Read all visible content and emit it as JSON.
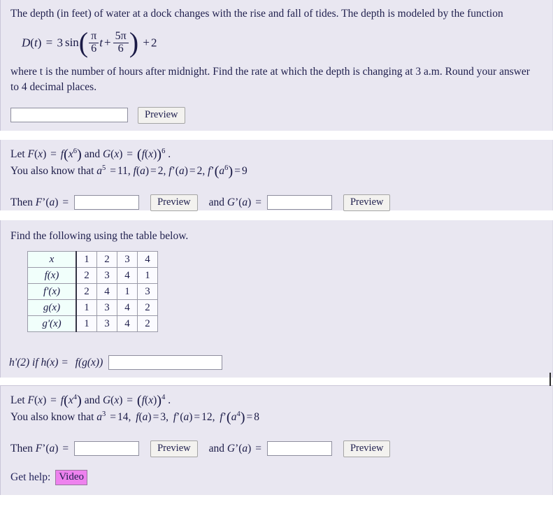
{
  "theme": {
    "panel_bg": "#e9e7f1",
    "page_bg": "#ffffff",
    "text_color": "#1f1f4d",
    "input_bg": "#ffffff",
    "button_bg": "#f3f2ef",
    "link_highlight": "#ee82ee",
    "table_head_bg": "#f1fffb",
    "table_cell_bg": "#fbfbff"
  },
  "problems": [
    {
      "id": "tides-problem",
      "prompt_line1": "The depth (in feet) of water at a dock changes with the rise and fall of tides. The depth is modeled by the function",
      "formula": {
        "lhs_fn": "D",
        "lhs_var": "t",
        "equals": "=",
        "coefficient": "3",
        "trig": "sin",
        "arg_frac1_num": "π",
        "arg_frac1_den": "6",
        "arg_var": "t",
        "arg_plus": "+",
        "arg_frac2_num": "5π",
        "arg_frac2_den": "6",
        "tail_plus": "+",
        "tail_const": "2"
      },
      "prompt_line2": "where t is the number of hours after midnight. Find the rate at which the depth is changing at 3 a.m.  Round your answer",
      "prompt_line3": "to 4 decimal places.",
      "answer_value": "",
      "answer_placeholder": "",
      "preview_label": "Preview"
    },
    {
      "id": "composite-power-6",
      "line1_prefix": "Let",
      "line1_F": "F",
      "line1_var": "x",
      "line1_eq": "=",
      "line1_f": "f",
      "line1_inner_var": "x",
      "line1_inner_exp": "6",
      "line1_and": "and",
      "line1_G": "G",
      "line1_outer_exp": "6",
      "line1_period": ".",
      "line2_prefix": "You also know that",
      "line2_a": "a",
      "line2_a_exp": "5",
      "line2_a_val": "11",
      "line2_fa_val": "2",
      "line2_fpa_val": "2",
      "line2_fpaexp": "6",
      "line2_fpaexp_val": "9",
      "then_label": "Then",
      "then_fn": "F",
      "then_arg": "a",
      "and_label": "and",
      "and_fn": "G",
      "and_arg": "a",
      "equals": "=",
      "answer_F_value": "",
      "answer_G_value": "",
      "preview_label": "Preview"
    },
    {
      "id": "table-chain-rule",
      "instruction": "Find the following using the table below.",
      "table": {
        "row_labels": [
          "x",
          "f(x)",
          "f'(x)",
          "g(x)",
          "g'(x)"
        ],
        "rows": [
          {
            "label": "x",
            "values": [
              "1",
              "2",
              "3",
              "4"
            ]
          },
          {
            "label": "f(x)",
            "values": [
              "2",
              "3",
              "4",
              "1"
            ]
          },
          {
            "label": "f'(x)",
            "values": [
              "2",
              "4",
              "1",
              "3"
            ]
          },
          {
            "label": "g(x)",
            "values": [
              "1",
              "3",
              "4",
              "2"
            ]
          },
          {
            "label": "g'(x)",
            "values": [
              "1",
              "3",
              "4",
              "2"
            ]
          }
        ]
      },
      "question_prefix": "h'(2) if h(x) =",
      "question_fn": "f(g(x))",
      "answer_value": "",
      "answer_placeholder": ""
    },
    {
      "id": "composite-power-4",
      "line1_prefix": "Let",
      "line1_F": "F",
      "line1_var": "x",
      "line1_eq": "=",
      "line1_f": "f",
      "line1_inner_var": "x",
      "line1_inner_exp": "4",
      "line1_and": "and",
      "line1_G": "G",
      "line1_outer_exp": "4",
      "line1_period": ".",
      "line2_prefix": "You also know that",
      "line2_a": "a",
      "line2_a_exp": "3",
      "line2_a_val": "14",
      "line2_fa_val": "3",
      "line2_fpa_val": "12",
      "line2_fpaexp": "4",
      "line2_fpaexp_val": "8",
      "then_label": "Then",
      "then_fn": "F",
      "then_arg": "a",
      "and_label": "and",
      "and_fn": "G",
      "and_arg": "a",
      "equals": "=",
      "answer_F_value": "",
      "answer_G_value": "",
      "preview_label": "Preview",
      "get_help_label": "Get help:",
      "video_link_label": "Video"
    }
  ]
}
